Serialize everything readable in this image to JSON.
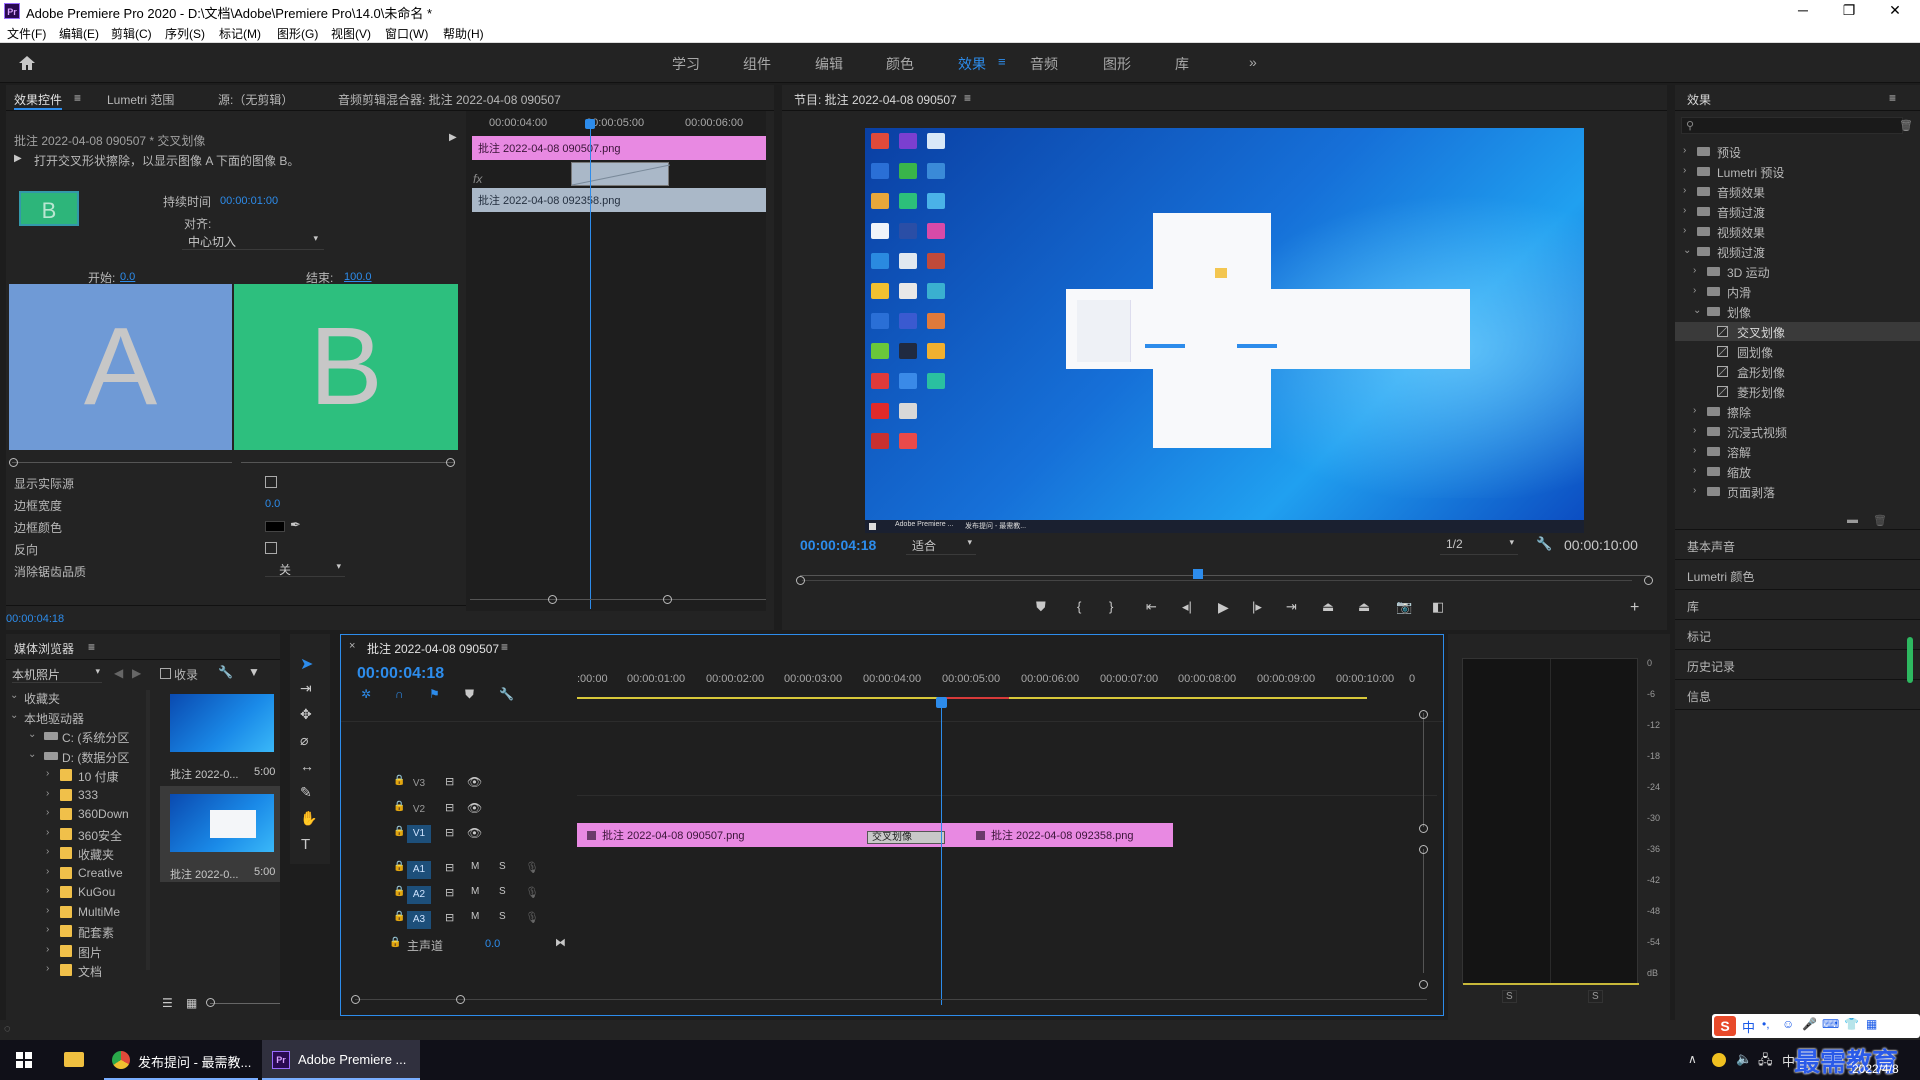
{
  "window": {
    "title": "Adobe Premiere Pro 2020 - D:\\文档\\Adobe\\Premiere Pro\\14.0\\未命名 *",
    "logo": "Pr"
  },
  "menu": [
    "文件(F)",
    "编辑(E)",
    "剪辑(C)",
    "序列(S)",
    "标记(M)",
    "图形(G)",
    "视图(V)",
    "窗口(W)",
    "帮助(H)"
  ],
  "workspaces": {
    "items": [
      "学习",
      "组件",
      "编辑",
      "颜色",
      "效果",
      "音频",
      "图形",
      "库"
    ],
    "active": "效果",
    "more": "»"
  },
  "effect_controls": {
    "tabs": [
      "效果控件",
      "Lumetri 范围",
      "源:（无剪辑）",
      "音频剪辑混合器: 批注 2022-04-08 090507"
    ],
    "clip_title": "批注 2022-04-08 090507 * 交叉划像",
    "description": "打开交叉形状擦除，以显示图像 A 下面的图像 B。",
    "preview_letter": "B",
    "duration_label": "持续时间",
    "duration_value": "00:00:01:00",
    "align_label": "对齐:",
    "align_value": "中心切入",
    "start_label": "开始:",
    "start_value": "0.0",
    "end_label": "结束:",
    "end_value": "100.0",
    "thumb_a": "A",
    "thumb_b": "B",
    "props": [
      {
        "label": "显示实际源",
        "value": ""
      },
      {
        "label": "边框宽度",
        "value": "0.0"
      },
      {
        "label": "边框颜色",
        "value": ""
      },
      {
        "label": "反向",
        "value": ""
      },
      {
        "label": "消除锯齿品质",
        "value": "关"
      }
    ],
    "ruler": [
      "00:00:04:00",
      "00:00:05:00",
      "00:00:06:00"
    ],
    "clip_a": "批注 2022-04-08 090507.png",
    "clip_b": "批注 2022-04-08 092358.png",
    "track_a": "A",
    "track_b": "B",
    "fx": "fx",
    "timecode": "00:00:04:18"
  },
  "program_monitor": {
    "title": "节目: 批注 2022-04-08 090507",
    "timecode": "00:00:04:18",
    "fit": "适合",
    "resolution": "1/2",
    "duration": "00:00:10:00",
    "playhead_fraction": 0.468,
    "taskbar_items": [
      "Adobe Premiere ...",
      "发布提问 - 最需教..."
    ]
  },
  "effects_panel": {
    "title": "效果",
    "search_placeholder": "",
    "tree": [
      {
        "label": "预设",
        "level": 0,
        "type": "folder",
        "open": false
      },
      {
        "label": "Lumetri 预设",
        "level": 0,
        "type": "folder",
        "open": false
      },
      {
        "label": "音频效果",
        "level": 0,
        "type": "folder",
        "open": false
      },
      {
        "label": "音频过渡",
        "level": 0,
        "type": "folder",
        "open": false
      },
      {
        "label": "视频效果",
        "level": 0,
        "type": "folder",
        "open": false
      },
      {
        "label": "视频过渡",
        "level": 0,
        "type": "folder",
        "open": true
      },
      {
        "label": "3D 运动",
        "level": 1,
        "type": "folder",
        "open": false
      },
      {
        "label": "内滑",
        "level": 1,
        "type": "folder",
        "open": false
      },
      {
        "label": "划像",
        "level": 1,
        "type": "folder",
        "open": true
      },
      {
        "label": "交叉划像",
        "level": 2,
        "type": "item",
        "selected": true
      },
      {
        "label": "圆划像",
        "level": 2,
        "type": "item"
      },
      {
        "label": "盒形划像",
        "level": 2,
        "type": "item"
      },
      {
        "label": "菱形划像",
        "level": 2,
        "type": "item"
      },
      {
        "label": "擦除",
        "level": 1,
        "type": "folder",
        "open": false
      },
      {
        "label": "沉浸式视频",
        "level": 1,
        "type": "folder",
        "open": false
      },
      {
        "label": "溶解",
        "level": 1,
        "type": "folder",
        "open": false
      },
      {
        "label": "缩放",
        "level": 1,
        "type": "folder",
        "open": false
      },
      {
        "label": "页面剥落",
        "level": 1,
        "type": "folder",
        "open": false
      }
    ],
    "other_panels": [
      "基本声音",
      "Lumetri 颜色",
      "库",
      "标记",
      "历史记录",
      "信息"
    ]
  },
  "media_browser": {
    "title": "媒体浏览器",
    "location": "本机照片",
    "favorites_toggle": "收录",
    "tree": [
      {
        "label": "收藏夹",
        "level": 0
      },
      {
        "label": "本地驱动器",
        "level": 0
      },
      {
        "label": "C: (系统分区",
        "level": 1
      },
      {
        "label": "D: (数据分区",
        "level": 1
      },
      {
        "label": "10 付康",
        "level": 2
      },
      {
        "label": "333",
        "level": 2
      },
      {
        "label": "360Down",
        "level": 2
      },
      {
        "label": "360安全",
        "level": 2
      },
      {
        "label": "收藏夹",
        "level": 2
      },
      {
        "label": "Creative",
        "level": 2
      },
      {
        "label": "KuGou",
        "level": 2
      },
      {
        "label": "MultiMe",
        "level": 2
      },
      {
        "label": "配套素",
        "level": 2
      },
      {
        "label": "图片",
        "level": 2
      },
      {
        "label": "文档",
        "level": 2
      }
    ],
    "thumbs": [
      {
        "name": "批注 2022-0...",
        "duration": "5:00"
      },
      {
        "name": "批注 2022-0...",
        "duration": "5:00"
      }
    ]
  },
  "timeline": {
    "title": "批注 2022-04-08 090507",
    "timecode": "00:00:04:18",
    "ruler": [
      ":00:00",
      "00:00:01:00",
      "00:00:02:00",
      "00:00:03:00",
      "00:00:04:00",
      "00:00:05:00",
      "00:00:06:00",
      "00:00:07:00",
      "00:00:08:00",
      "00:00:09:00",
      "00:00:10:00",
      "0"
    ],
    "video_tracks": [
      "V3",
      "V2",
      "V1"
    ],
    "audio_tracks": [
      "A1",
      "A2",
      "A3"
    ],
    "mute": "M",
    "solo": "S",
    "master_label": "主声道",
    "master_value": "0.0",
    "clip1": "批注 2022-04-08 090507.png",
    "clip2": "批注 2022-04-08 092358.png",
    "transition": "交叉划像"
  },
  "audio_meter": {
    "scale": [
      "0",
      "-6",
      "-12",
      "-18",
      "-24",
      "-30",
      "-36",
      "-42",
      "-48",
      "-54",
      "dB"
    ],
    "channels": [
      "S",
      "S"
    ]
  },
  "taskbar": {
    "items": [
      "发布提问 - 最需教...",
      "Adobe Premiere ..."
    ],
    "date": "2022/4/8",
    "watermark": "最需教育",
    "ime": "中"
  }
}
